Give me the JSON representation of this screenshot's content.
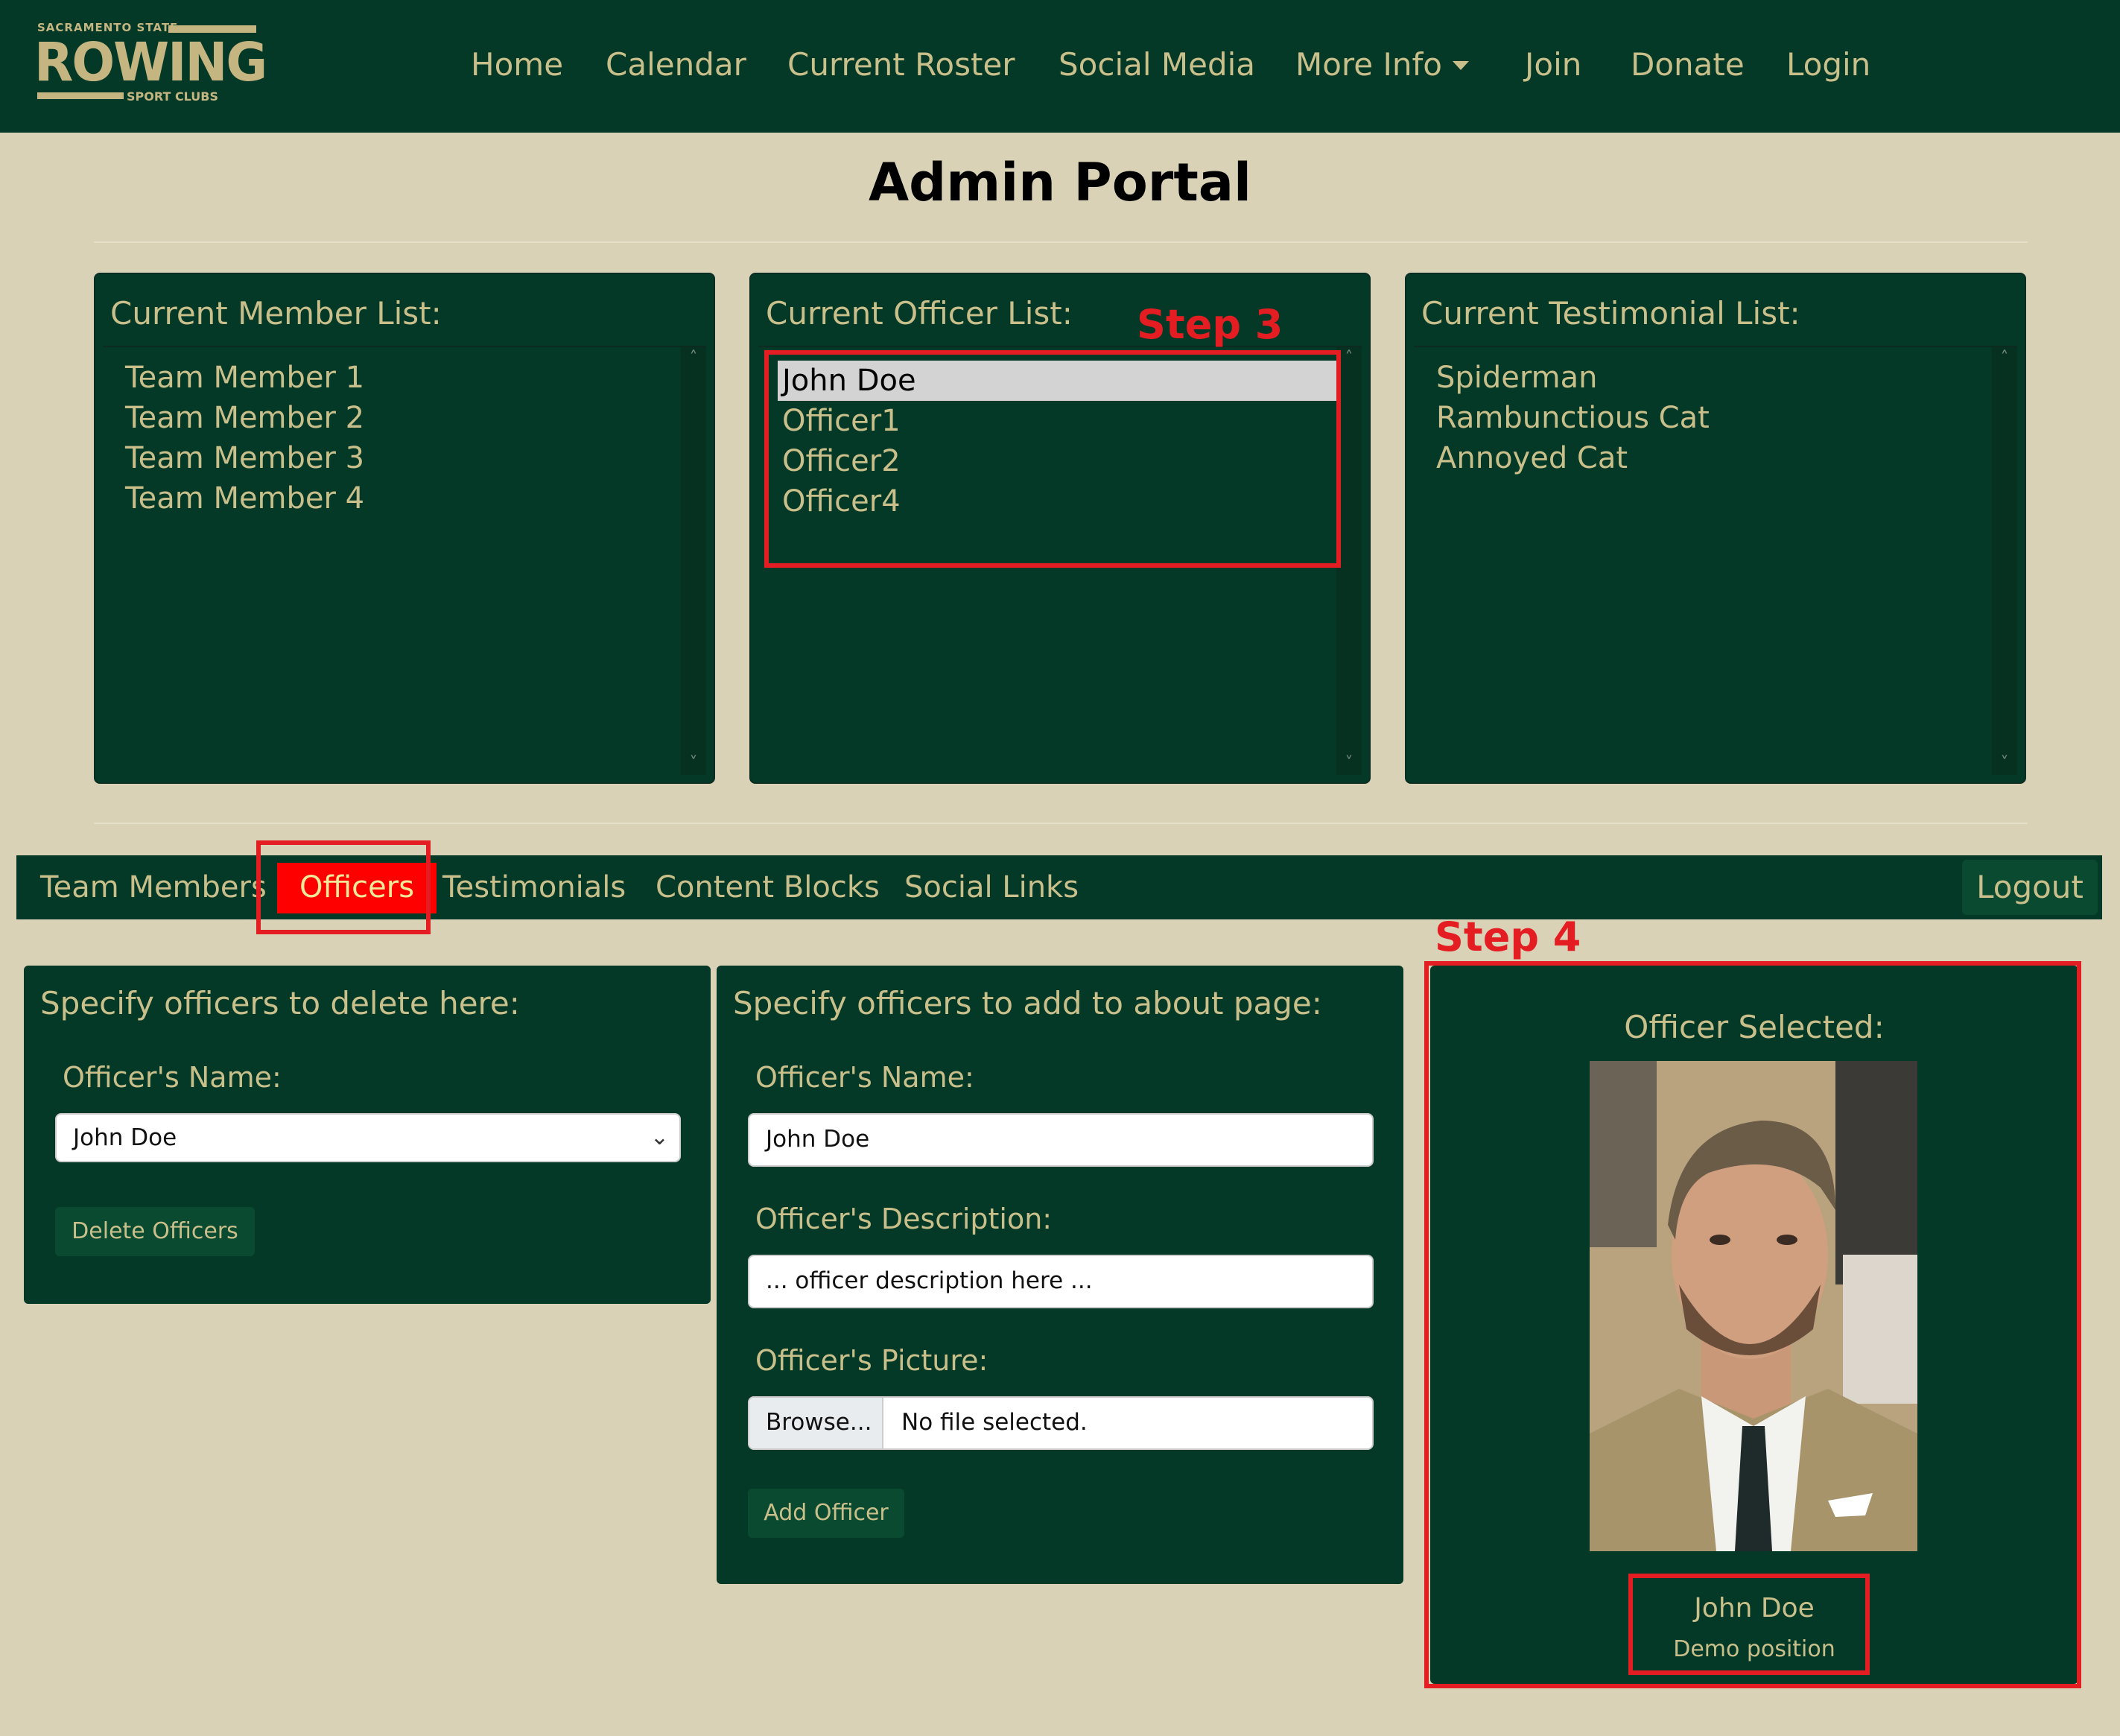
{
  "brand": {
    "top_text": "SACRAMENTO STATE",
    "main_text": "ROWING",
    "bottom_text": "SPORT CLUBS"
  },
  "nav": {
    "items": [
      "Home",
      "Calendar",
      "Current Roster",
      "Social Media",
      "More Info",
      "Join",
      "Donate",
      "Login"
    ]
  },
  "page_title": "Admin Portal",
  "member_list": {
    "heading": "Current Member List:",
    "items": [
      "Team Member 1",
      "Team Member 2",
      "Team Member 3",
      "Team Member 4"
    ]
  },
  "officer_list": {
    "heading": "Current Officer List:",
    "items": [
      "John Doe",
      "Officer1",
      "Officer2",
      "Officer4"
    ],
    "selected": "John Doe"
  },
  "testimonial_list": {
    "heading": "Current Testimonial List:",
    "items": [
      "Spiderman",
      "Rambunctious Cat",
      "Annoyed Cat"
    ]
  },
  "tabs": {
    "items": [
      "Team Members",
      "Officers",
      "Testimonials",
      "Content Blocks",
      "Social Links"
    ],
    "active": "Officers",
    "logout": "Logout"
  },
  "delete_card": {
    "heading": "Specify officers to delete here:",
    "name_label": "Officer's Name:",
    "selected_name": "John Doe",
    "button": "Delete Officers"
  },
  "add_card": {
    "heading": "Specify officers to add to about page:",
    "name_label": "Officer's Name:",
    "name_value": "John Doe",
    "description_label": "Officer's Description:",
    "description_value": "... officer description here ...",
    "picture_label": "Officer's Picture:",
    "browse_label": "Browse...",
    "file_status": "No file selected.",
    "button": "Add Officer"
  },
  "selected_card": {
    "heading": "Officer Selected:",
    "name": "John Doe",
    "position": "Demo position"
  },
  "annotations": {
    "step3": "Step 3",
    "step4": "Step 4",
    "color": "#e41d23"
  },
  "colors": {
    "primary_green": "#043927",
    "gold": "#c4b581",
    "background": "#d9d2b7",
    "active_tab": "#ff0000"
  }
}
